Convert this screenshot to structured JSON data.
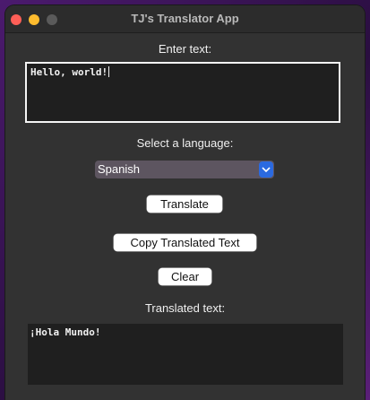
{
  "window": {
    "title": "TJ's Translator App"
  },
  "input": {
    "label": "Enter text:",
    "value": "Hello, world!"
  },
  "language": {
    "label": "Select a language:",
    "selected": "Spanish"
  },
  "buttons": {
    "translate": "Translate",
    "copy": "Copy Translated Text",
    "clear": "Clear"
  },
  "output": {
    "label": "Translated text:",
    "value": "¡Hola Mundo!"
  },
  "icons": {
    "close": "close-icon",
    "minimize": "minimize-icon",
    "maximize": "maximize-icon",
    "dropdown": "chevron-down-icon"
  },
  "colors": {
    "close": "#fe5f57",
    "minimize": "#febc2e",
    "maximize": "#5a5a5a",
    "accent": "#2b6ae0"
  }
}
